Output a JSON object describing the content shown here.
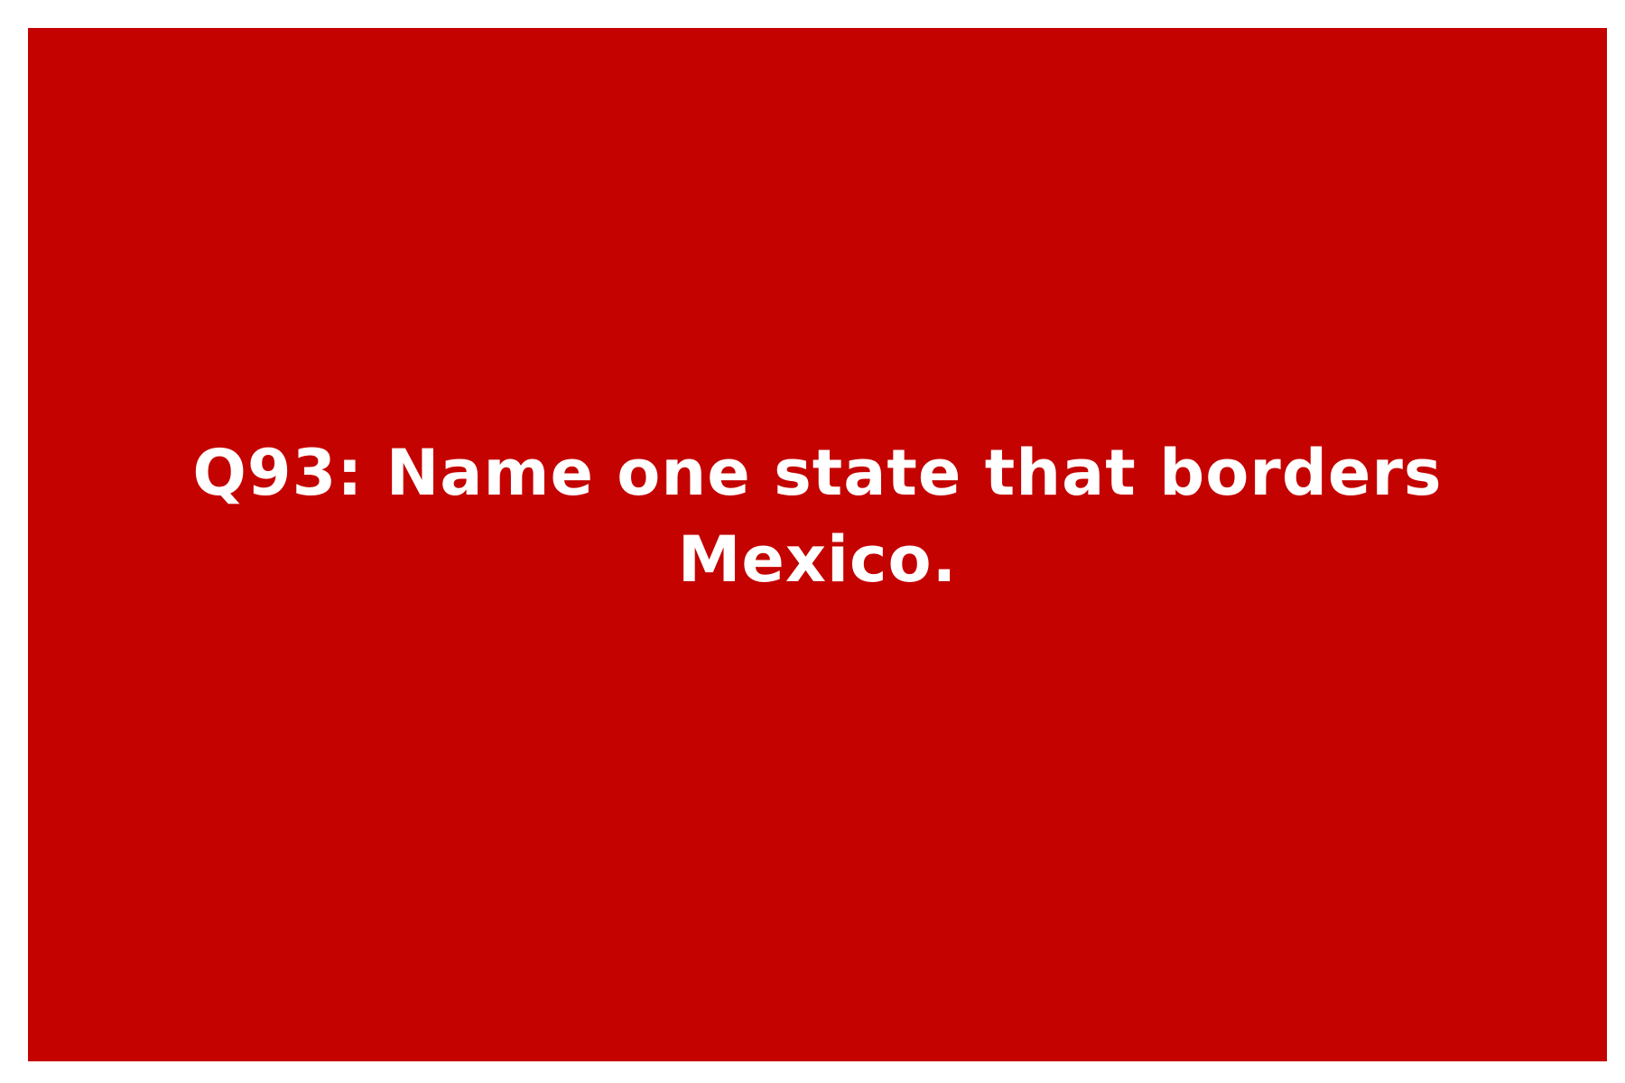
{
  "card": {
    "question_text": "Q93: Name one state that borders Mexico.",
    "background_color": "#c40200",
    "text_color": "#ffffff"
  }
}
